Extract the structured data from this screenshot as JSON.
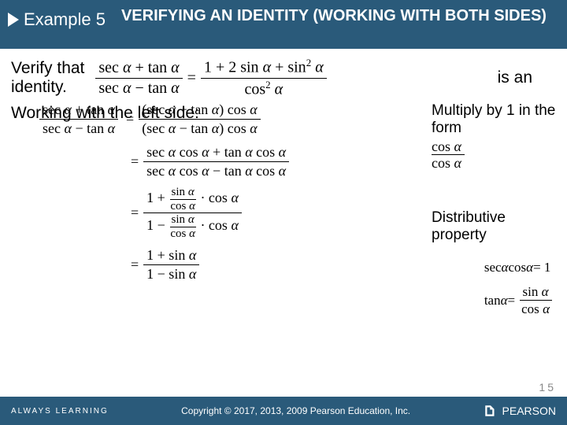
{
  "header": {
    "example_label": "Example 5",
    "title": "VERIFYING AN IDENTITY (WORKING WITH BOTH SIDES)"
  },
  "body": {
    "verify_prefix": "Verify that",
    "verify_suffix": "identity.",
    "is_an": "is an",
    "working_left": "Working with the left side:",
    "main_formula": {
      "lhs_num": "sec α + tan α",
      "lhs_den": "sec α − tan α",
      "rhs_num": "1 + 2 sin α + sin² α",
      "rhs_den": "cos² α"
    },
    "steps": [
      {
        "lhs_num": "sec α + tan α",
        "lhs_den": "sec α − tan α",
        "rhs_num": "(sec α + tan α) cos α",
        "rhs_den": "(sec α − tan α) cos α"
      },
      {
        "lhs": "",
        "rhs_num": "sec α cos α + tan α cos α",
        "rhs_den": "sec α cos α − tan α cos α"
      },
      {
        "lhs": "",
        "rhs_num_compound": "1 + (sin α / cos α) · cos α",
        "rhs_den_compound": "1 − (sin α / cos α) · cos α"
      },
      {
        "lhs": "",
        "rhs_num": "1 + sin α",
        "rhs_den": "1 − sin α"
      }
    ],
    "notes": {
      "multiply": "Multiply by 1 in the form",
      "multiply_frac_num": "cos α",
      "multiply_frac_den": "cos α",
      "distributive": "Distributive property"
    },
    "side_identities": {
      "id1_lhs": "sec α cos α",
      "id1_rhs": "1",
      "id2_lhs": "tan α",
      "id2_rhs_num": "sin α",
      "id2_rhs_den": "cos α"
    }
  },
  "footer": {
    "always": "ALWAYS LEARNING",
    "copyright": "Copyright © 2017, 2013, 2009 Pearson Education, Inc.",
    "brand": "PEARSON",
    "page": "15"
  }
}
